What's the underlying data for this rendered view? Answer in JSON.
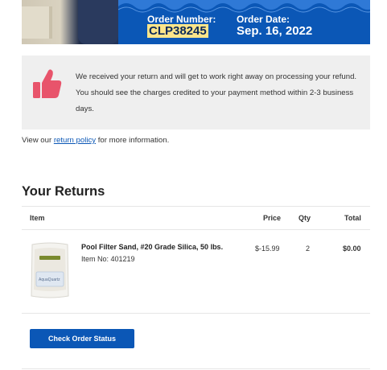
{
  "header": {
    "order_number_label": "Order Number:",
    "order_number_value": "CLP38245",
    "order_date_label": "Order Date:",
    "order_date_value": "Sep. 16, 2022"
  },
  "notice": {
    "icon": "thumbs-up-icon",
    "text": "We received your return and will get to work right away on processing your refund. You should see the charges credited to your payment method within 2-3 business days."
  },
  "policy": {
    "prefix": "View our ",
    "link": "return policy",
    "suffix": " for more information."
  },
  "returns": {
    "title": "Your Returns",
    "columns": {
      "item": "Item",
      "price": "Price",
      "qty": "Qty",
      "total": "Total"
    },
    "items": [
      {
        "name": "Pool Filter Sand, #20 Grade Silica, 50 lbs.",
        "sku": "Item No: 401219",
        "price": "$-15.99",
        "qty": "2",
        "total": "$0.00"
      }
    ]
  },
  "actions": {
    "check_status": "Check Order Status"
  },
  "colors": {
    "brand_blue": "#0b57b6",
    "highlight": "#fce58a",
    "thumb": "#e8546b"
  }
}
